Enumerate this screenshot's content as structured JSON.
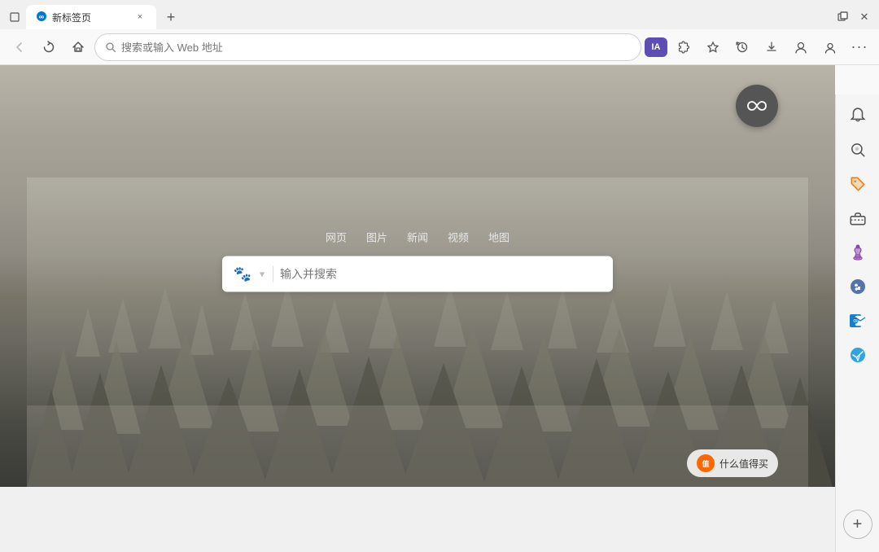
{
  "browser": {
    "tab": {
      "favicon": "∞",
      "title": "新标签页",
      "close": "×"
    },
    "new_tab": "+",
    "window_controls": {
      "restore": "🗗",
      "close": "✕"
    }
  },
  "navbar": {
    "back_label": "‹",
    "forward_label": "›",
    "refresh_label": "↻",
    "home_label": "⌂",
    "address_placeholder": "搜索或输入 Web 地址",
    "ia_label": "IA",
    "bookmark_label": "☆",
    "bookmarks_label": "☆",
    "history_label": "⏱",
    "download_label": "↓",
    "extensions_label": "⚙",
    "profile_label": "👤",
    "more_label": "···"
  },
  "sidebar": {
    "notifications_icon": "🔔",
    "search_icon": "🔍",
    "tag_icon": "🏷",
    "tools_icon": "🧰",
    "chess_icon": "♟",
    "puzzle_icon": "🧩",
    "outlook_icon": "📧",
    "telegram_icon": "✈",
    "add_icon": "+"
  },
  "infinity_btn": "∞",
  "search": {
    "tabs": [
      "网页",
      "图片",
      "新闻",
      "视频",
      "地图"
    ],
    "placeholder": "输入并搜索",
    "engine_icon": "🐾"
  },
  "watermark": {
    "logo_text": "值",
    "text": "什么值得买"
  }
}
